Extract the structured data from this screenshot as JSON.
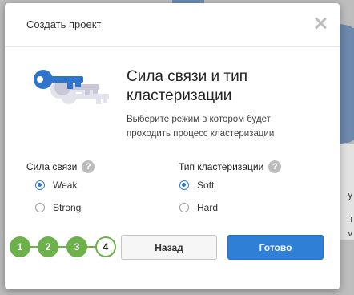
{
  "modal": {
    "title": "Создать проект",
    "heading": "Сила связи и тип кластеризации",
    "description": "Выберите режим в котором будет проходить процесс кластеризации"
  },
  "link_strength": {
    "label": "Сила связи",
    "options": [
      "Weak",
      "Strong"
    ],
    "selected": "Weak"
  },
  "clustering_type": {
    "label": "Тип кластеризации",
    "options": [
      "Soft",
      "Hard"
    ],
    "selected": "Soft"
  },
  "steps": [
    "1",
    "2",
    "3",
    "4"
  ],
  "current_step": "4",
  "buttons": {
    "back": "Назад",
    "done": "Готово"
  },
  "background": {
    "fragment_1": "y",
    "fragment_2": "i",
    "fragment_3": "v"
  },
  "colors": {
    "accent": "#2f7fd6",
    "step_green": "#6cb14a"
  }
}
